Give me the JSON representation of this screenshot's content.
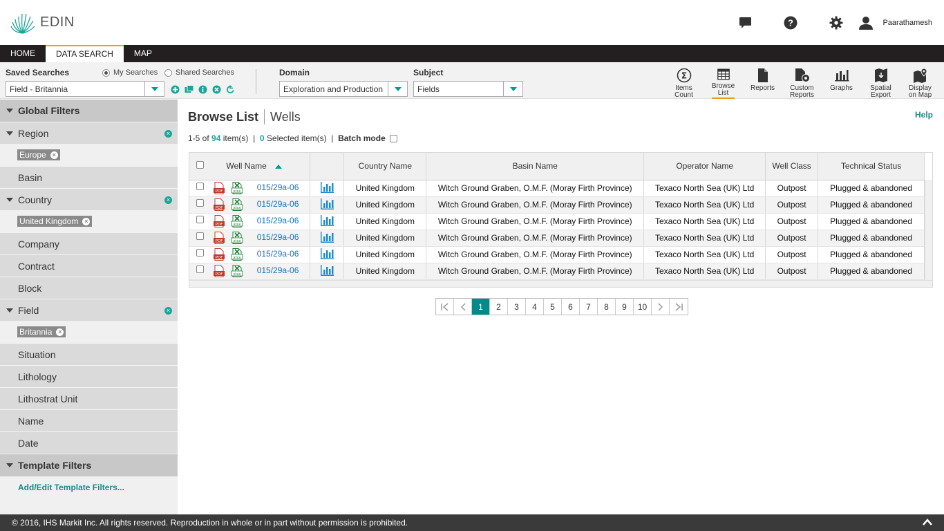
{
  "app": {
    "name": "EDIN",
    "user": "Paarathamesh"
  },
  "nav": {
    "tabs": [
      "HOME",
      "DATA SEARCH",
      "MAP"
    ]
  },
  "toolbar": {
    "saved_searches_label": "Saved Searches",
    "my_searches": "My Searches",
    "shared_searches": "Shared Searches",
    "saved_search_value": "Field - Britannia",
    "domain_label": "Domain",
    "domain_value": "Exploration and Production",
    "subject_label": "Subject",
    "subject_value": "Fields",
    "tools": [
      {
        "line1": "Items",
        "line2": "Count"
      },
      {
        "line1": "Browse",
        "line2": "List"
      },
      {
        "line1": "Reports",
        "line2": ""
      },
      {
        "line1": "Custom",
        "line2": "Reports"
      },
      {
        "line1": "Graphs",
        "line2": ""
      },
      {
        "line1": "Spatial",
        "line2": "Export"
      },
      {
        "line1": "Display",
        "line2": "on Map"
      }
    ]
  },
  "sidebar": {
    "global_filters": "Global Filters",
    "region": "Region",
    "region_chip": "Europe",
    "basin": "Basin",
    "country": "Country",
    "country_chip": "United Kingdom",
    "company": "Company",
    "contract": "Contract",
    "block": "Block",
    "field": "Field",
    "field_chip": "Britannia",
    "situation": "Situation",
    "lithology": "Lithology",
    "lithostrat": "Lithostrat Unit",
    "name": "Name",
    "date": "Date",
    "template_filters": "Template Filters",
    "add_edit": "Add/Edit Template Filters..."
  },
  "main": {
    "title": "Browse List",
    "subtitle": "Wells",
    "help": "Help",
    "summary": {
      "range": "1-5 of",
      "total": "94",
      "items": "item(s)",
      "selected": "0",
      "selected_label": "Selected item(s)",
      "batch_mode": "Batch mode",
      "sep": "|"
    },
    "columns": {
      "well_name": "Well Name",
      "country": "Country Name",
      "basin": "Basin Name",
      "operator": "Operator Name",
      "well_class": "Well Class",
      "status": "Technical Status"
    },
    "file_labels": {
      "pdf": "PDF",
      "xlsx": "xlsx"
    },
    "rows": [
      {
        "well": "015/29a-06",
        "country": "United Kingdom",
        "basin": "Witch Ground Graben, O.M.F. (Moray Firth Province)",
        "operator": "Texaco North Sea (UK) Ltd",
        "class": "Outpost",
        "status": "Plugged & abandoned"
      },
      {
        "well": "015/29a-06",
        "country": "United Kingdom",
        "basin": "Witch Ground Graben, O.M.F. (Moray Firth Province)",
        "operator": "Texaco North Sea (UK) Ltd",
        "class": "Outpost",
        "status": "Plugged & abandoned"
      },
      {
        "well": "015/29a-06",
        "country": "United Kingdom",
        "basin": "Witch Ground Graben, O.M.F. (Moray Firth Province)",
        "operator": "Texaco North Sea (UK) Ltd",
        "class": "Outpost",
        "status": "Plugged & abandoned"
      },
      {
        "well": "015/29a-06",
        "country": "United Kingdom",
        "basin": "Witch Ground Graben, O.M.F. (Moray Firth Province)",
        "operator": "Texaco North Sea (UK) Ltd",
        "class": "Outpost",
        "status": "Plugged & abandoned"
      },
      {
        "well": "015/29a-06",
        "country": "United Kingdom",
        "basin": "Witch Ground Graben, O.M.F. (Moray Firth Province)",
        "operator": "Texaco North Sea (UK) Ltd",
        "class": "Outpost",
        "status": "Plugged & abandoned"
      },
      {
        "well": "015/29a-06",
        "country": "United Kingdom",
        "basin": "Witch Ground Graben, O.M.F. (Moray Firth Province)",
        "operator": "Texaco North Sea (UK) Ltd",
        "class": "Outpost",
        "status": "Plugged & abandoned"
      }
    ],
    "pages": [
      "1",
      "2",
      "3",
      "4",
      "5",
      "6",
      "7",
      "8",
      "9",
      "10"
    ]
  },
  "footer": {
    "copyright": "© 2016, IHS Markit Inc. All rights reserved. Reproduction in whole or in part without permission is prohibited."
  },
  "colors": {
    "accent": "#009b9b",
    "tab_highlight": "#f39c12",
    "navbar": "#231f20",
    "footer": "#3a3a3a"
  }
}
